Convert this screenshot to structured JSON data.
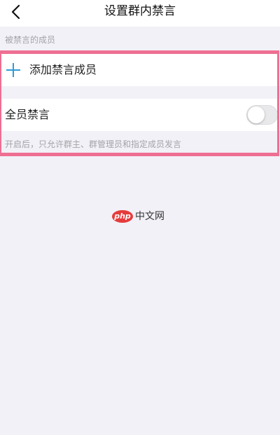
{
  "header": {
    "title": "设置群内禁言"
  },
  "muted_members": {
    "section_label": "被禁言的成员",
    "add_label": "添加禁言成员"
  },
  "mute_all": {
    "label": "全员禁言",
    "enabled": false,
    "hint": "开启后，只允许群主、群管理员和指定成员发言"
  },
  "watermark": {
    "logo": "php",
    "text": "中文网"
  },
  "colors": {
    "plus_icon": "#2f9cd6",
    "highlight": "#ee6f92",
    "background": "#f2f1f7"
  }
}
